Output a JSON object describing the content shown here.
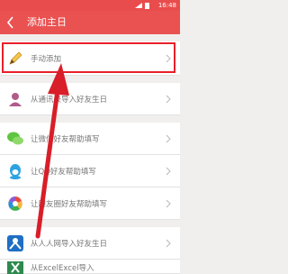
{
  "status_bar": {
    "time": "16:48"
  },
  "header": {
    "title": "添加主日"
  },
  "items": [
    {
      "label": "手动添加",
      "icon": "pencil-icon"
    },
    {
      "label": "从通讯录导入好友生日",
      "icon": "contact-icon"
    },
    {
      "label": "让微信好友帮助填写",
      "icon": "wechat-icon"
    },
    {
      "label": "让QQ好友帮助填写",
      "icon": "qq-icon"
    },
    {
      "label": "让朋友圈好友帮助填写",
      "icon": "moments-icon"
    },
    {
      "label": "从人人网导入好友生日",
      "icon": "renren-icon"
    },
    {
      "label": "从ExcelExcel导入",
      "icon": "excel-icon"
    }
  ],
  "colors": {
    "header": "#ea5151",
    "highlight": "#e8202a",
    "arrow": "#d81e28"
  }
}
